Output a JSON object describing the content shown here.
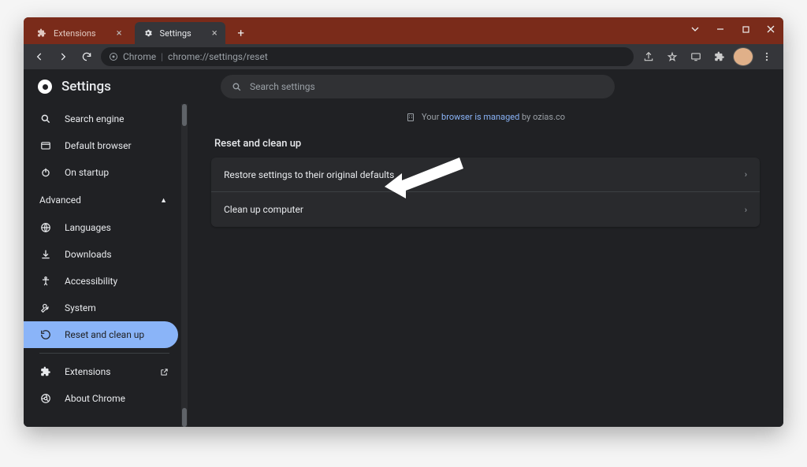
{
  "tabs": {
    "inactive": {
      "label": "Extensions"
    },
    "active": {
      "label": "Settings"
    }
  },
  "url": {
    "scheme": "Chrome",
    "path": "chrome://settings/reset"
  },
  "app": {
    "title": "Settings"
  },
  "search": {
    "placeholder": "Search settings"
  },
  "sidebar": {
    "top": [
      {
        "icon": "search-icon",
        "label": "Search engine"
      },
      {
        "icon": "browser-icon",
        "label": "Default browser"
      },
      {
        "icon": "power-icon",
        "label": "On startup"
      }
    ],
    "section": {
      "label": "Advanced"
    },
    "advanced": [
      {
        "icon": "globe-icon",
        "label": "Languages"
      },
      {
        "icon": "download-icon",
        "label": "Downloads"
      },
      {
        "icon": "accessibility-icon",
        "label": "Accessibility"
      },
      {
        "icon": "wrench-icon",
        "label": "System"
      },
      {
        "icon": "restore-icon",
        "label": "Reset and clean up",
        "active": true
      }
    ],
    "bottom": [
      {
        "icon": "puzzle-icon",
        "label": "Extensions",
        "external": true
      },
      {
        "icon": "chrome-icon",
        "label": "About Chrome"
      }
    ]
  },
  "managed": {
    "prefix": "Your ",
    "link": "browser is managed",
    "suffix": " by ozias.co"
  },
  "main": {
    "section_title": "Reset and clean up",
    "rows": [
      {
        "label": "Restore settings to their original defaults"
      },
      {
        "label": "Clean up computer"
      }
    ]
  }
}
